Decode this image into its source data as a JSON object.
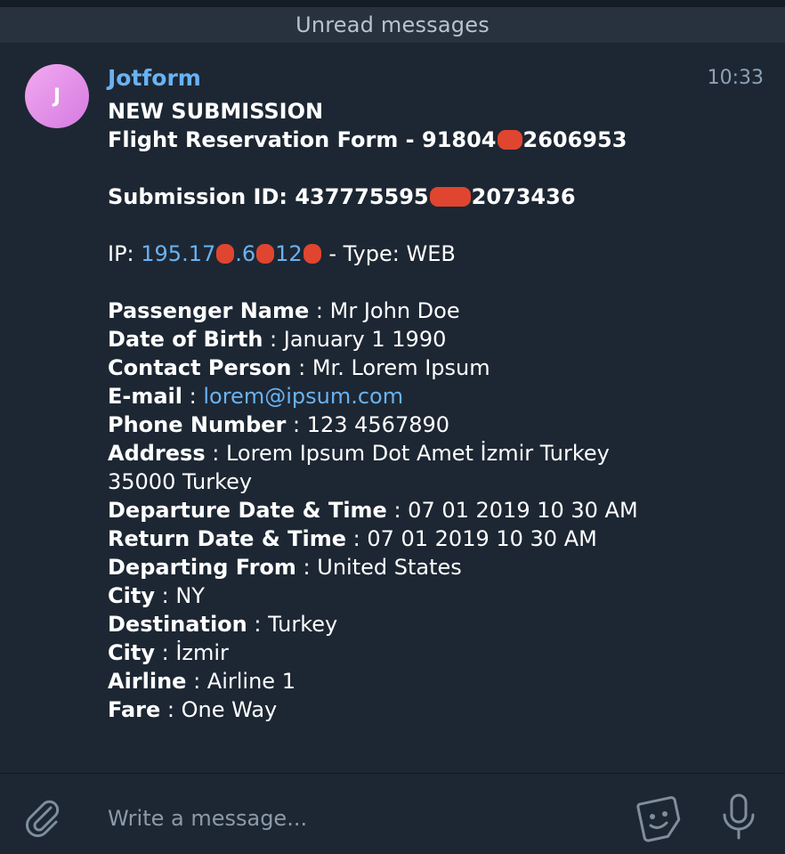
{
  "banner": {
    "unread_label": "Unread messages"
  },
  "message": {
    "avatar_initial": "J",
    "sender": "Jotform",
    "time": "10:33",
    "heading": "NEW SUBMISSION",
    "form_title_start": "Flight Reservation Form - 91804",
    "form_title_end": "2606953",
    "submission_label": "Submission ID: ",
    "submission_start": "437775595",
    "submission_end": "2073436",
    "ip_label": "IP: ",
    "ip_part1": "195.17",
    "ip_part2": ".6",
    "ip_part3": "12",
    "ip_type": " - Type: WEB",
    "fields": [
      {
        "label": "Passenger Name",
        "value": "Mr John Doe"
      },
      {
        "label": "Date of Birth",
        "value": "January 1 1990"
      },
      {
        "label": "Contact Person",
        "value": "Mr. Lorem Ipsum"
      },
      {
        "label": "E-mail",
        "value": "lorem@ipsum.com"
      },
      {
        "label": "Phone Number",
        "value": "123 4567890"
      },
      {
        "label": "Address",
        "value": "Lorem Ipsum Dot Amet İzmir Turkey",
        "continuation": "35000 Turkey"
      },
      {
        "label": "Departure Date & Time",
        "value": "07 01 2019 10 30 AM"
      },
      {
        "label": "Return Date & Time",
        "value": "07 01 2019 10 30 AM"
      },
      {
        "label": "Departing From",
        "value": "United States"
      },
      {
        "label": "City",
        "value": "NY"
      },
      {
        "label": "Destination",
        "value": "Turkey"
      },
      {
        "label": "City",
        "value": "İzmir"
      },
      {
        "label": "Airline",
        "value": "Airline 1"
      },
      {
        "label": "Fare",
        "value": "One Way"
      }
    ],
    "separator": " : "
  },
  "composer": {
    "placeholder": "Write a message...",
    "attach_icon": "paperclip-icon",
    "sticker_icon": "sticker-icon",
    "mic_icon": "microphone-icon"
  },
  "colors": {
    "background": "#1d2733",
    "banner": "#28323f",
    "accent": "#6ab2f2",
    "redaction": "#e0452f"
  }
}
